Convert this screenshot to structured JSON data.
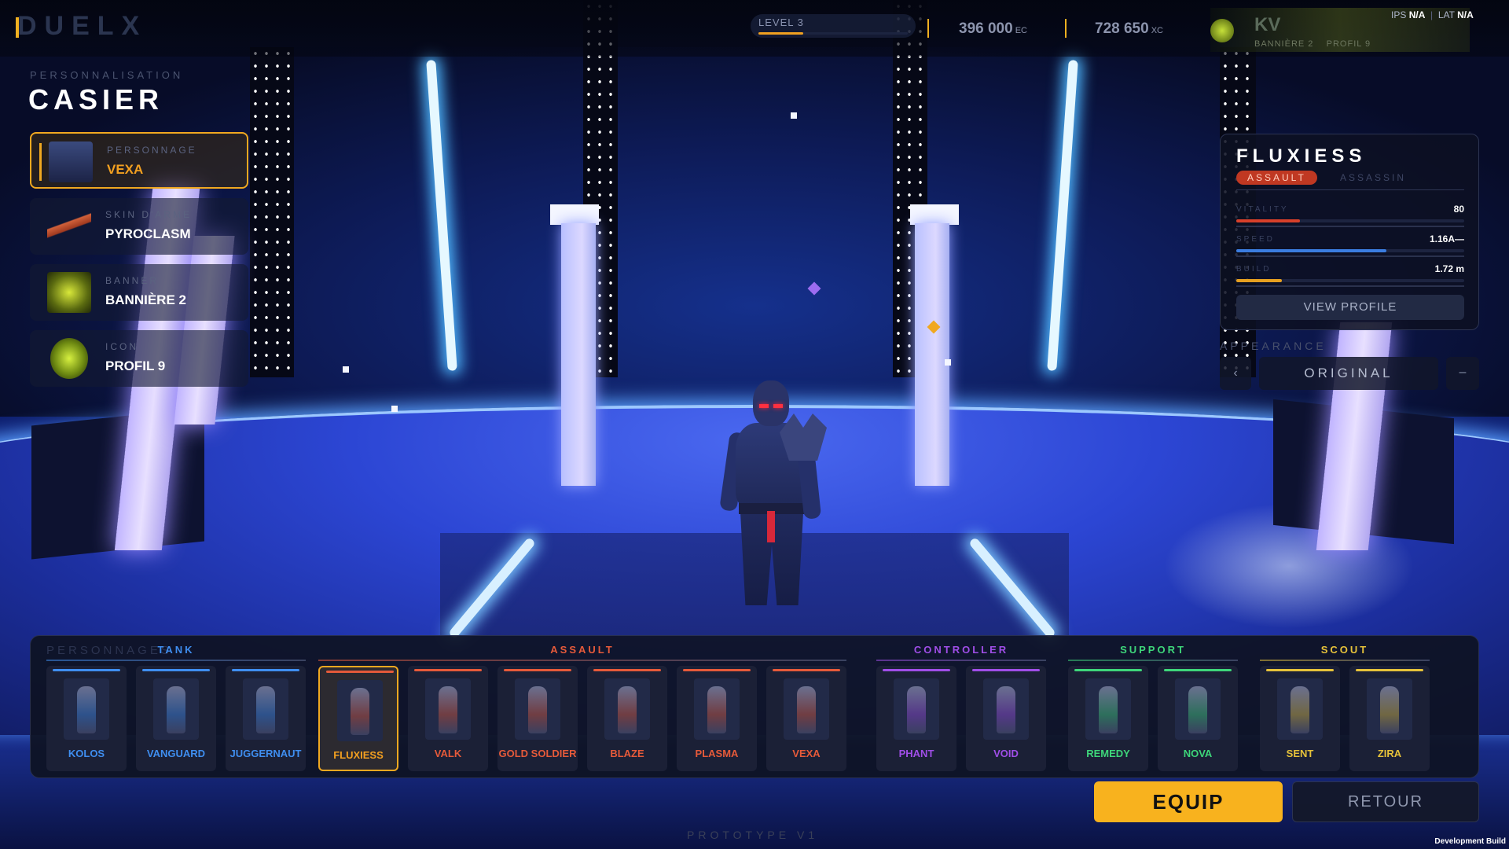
{
  "header": {
    "logo": "DUELX",
    "level_label": "LEVEL 3",
    "level_progress": 0.3,
    "currency_ec": {
      "value": "396 000",
      "unit": "EC"
    },
    "currency_xc": {
      "value": "728 650",
      "unit": "XC"
    },
    "profile": {
      "name": "KV",
      "banner": "BANNIÈRE 2",
      "icon": "PROFIL 9"
    },
    "ips_label": "IPS",
    "ips_value": "N/A",
    "lat_label": "LAT",
    "lat_value": "N/A",
    "net_separator": "|"
  },
  "section": {
    "subtitle": "PERSONNALISATION",
    "title": "CASIER"
  },
  "slots": [
    {
      "category": "PERSONNAGE",
      "name": "VEXA",
      "icon": "character-thumb",
      "active": true
    },
    {
      "category": "SKIN D'ARME",
      "name": "PYROCLASM",
      "icon": "rifle-thumb",
      "active": false
    },
    {
      "category": "BANNER",
      "name": "BANNIÈRE 2",
      "icon": "banner-thumb",
      "active": false
    },
    {
      "category": "ICON",
      "name": "PROFIL 9",
      "icon": "profile-icon-thumb",
      "active": false
    }
  ],
  "details": {
    "name": "FLUXIESS",
    "primary_role": "ASSAULT",
    "secondary_role": "ASSASSIN",
    "stats": [
      {
        "label": "VITALITY",
        "value": "80",
        "fill": 0.28,
        "color": "#d8402a"
      },
      {
        "label": "SPEED",
        "value": "1.16A—",
        "fill": 0.66,
        "color": "#3b7de0"
      },
      {
        "label": "BUILD",
        "value": "1.72 m",
        "fill": 0.2,
        "color": "#e6a020"
      }
    ],
    "view_profile": "VIEW PROFILE"
  },
  "appearance": {
    "label": "APPEARANCE",
    "value": "ORIGINAL",
    "next": "–",
    "prev": "‹"
  },
  "roster": {
    "title": "PERSONNAGES",
    "groups": [
      {
        "name": "TANK",
        "color": "#3f8ef0",
        "characters": [
          "KOLOS",
          "VANGUARD",
          "JUGGERNAUT"
        ]
      },
      {
        "name": "ASSAULT",
        "color": "#e65a3a",
        "characters": [
          "FLUXIESS",
          "VALK",
          "GOLD SOLDIER",
          "BLAZE",
          "PLASMA",
          "VEXA"
        ]
      },
      {
        "name": "CONTROLLER",
        "color": "#a04ee8",
        "characters": [
          "PHANT",
          "VOID"
        ]
      },
      {
        "name": "SUPPORT",
        "color": "#3ed67a",
        "characters": [
          "REMEDY",
          "NOVA"
        ]
      },
      {
        "name": "SCOUT",
        "color": "#e6c23a",
        "characters": [
          "SENT",
          "ZIRA"
        ]
      }
    ],
    "selected": "FLUXIESS"
  },
  "buttons": {
    "equip": "EQUIP",
    "back": "RETOUR"
  },
  "footer": {
    "build_label": "PROTOTYPE V1",
    "dev_build": "Development Build"
  },
  "colors": {
    "accent": "#f8b21e",
    "scene_floor": "#2c46d4",
    "neon": "#50b8ff"
  }
}
